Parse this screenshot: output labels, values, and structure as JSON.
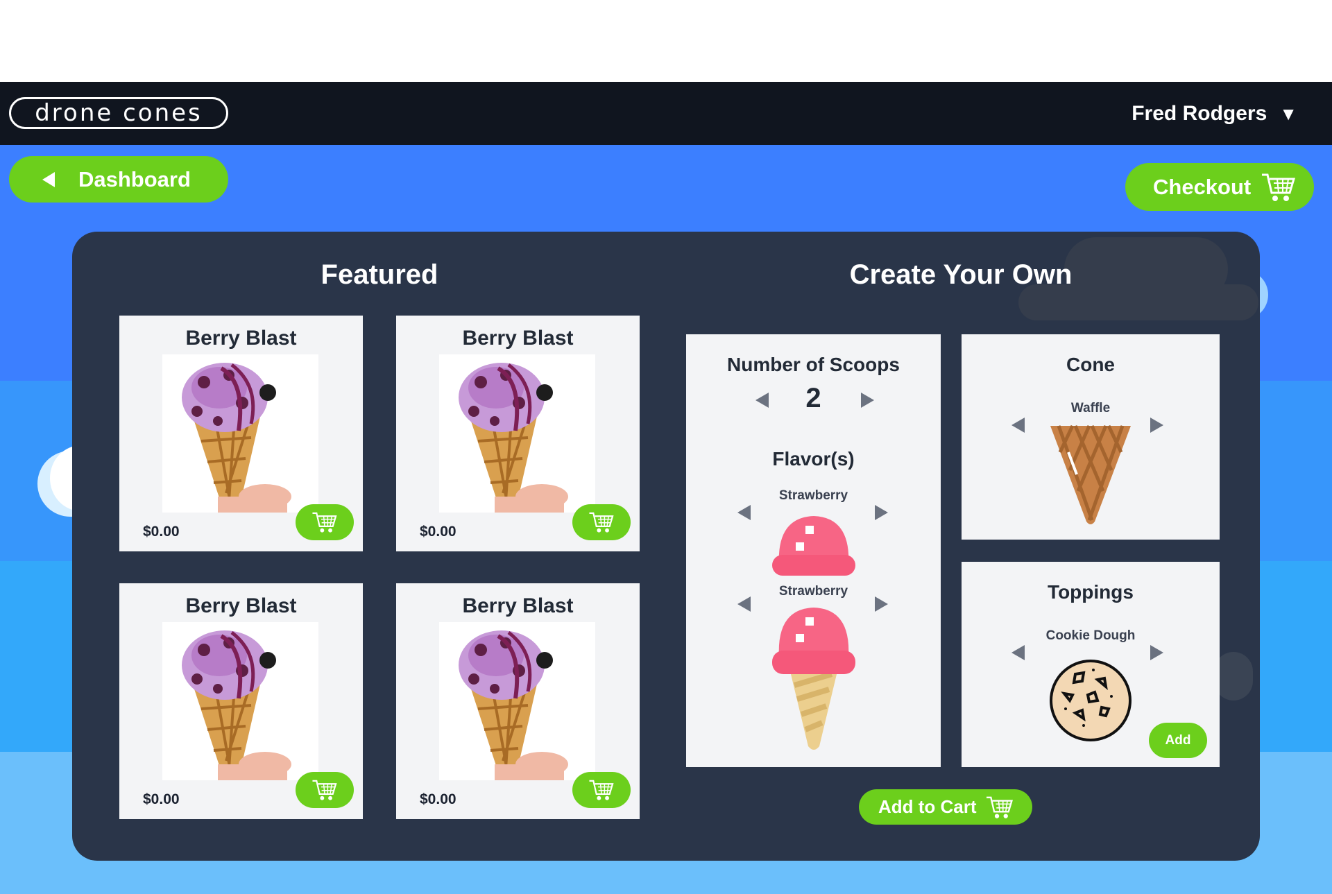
{
  "header": {
    "logo_text": "drone cones",
    "user_name": "Fred Rodgers",
    "user_caret": "▼"
  },
  "nav": {
    "dashboard_label": "Dashboard",
    "checkout_label": "Checkout"
  },
  "featured": {
    "title": "Featured",
    "items": [
      {
        "name": "Berry Blast",
        "price": "$0.00"
      },
      {
        "name": "Berry Blast",
        "price": "$0.00"
      },
      {
        "name": "Berry Blast",
        "price": "$0.00"
      },
      {
        "name": "Berry Blast",
        "price": "$0.00"
      }
    ]
  },
  "create": {
    "title": "Create Your Own",
    "scoops": {
      "label": "Number of Scoops",
      "value": "2"
    },
    "flavors": {
      "label": "Flavor(s)",
      "items": [
        "Strawberry",
        "Strawberry"
      ]
    },
    "cone": {
      "label": "Cone",
      "value": "Waffle"
    },
    "toppings": {
      "label": "Toppings",
      "value": "Cookie Dough",
      "add_label": "Add"
    },
    "add_to_cart_label": "Add to Cart"
  },
  "colors": {
    "accent_green": "#6ccf1c",
    "panel": "#2a3549",
    "topbar": "#10151f",
    "sky": "#3c7fff"
  }
}
